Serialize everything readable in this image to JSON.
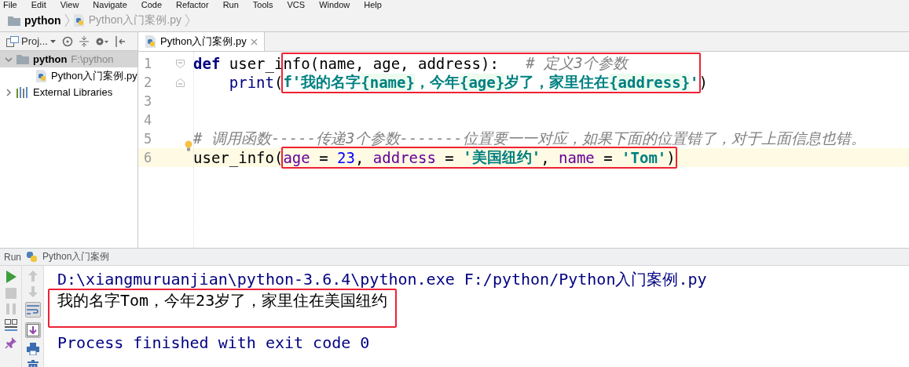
{
  "menu": [
    "File",
    "Edit",
    "View",
    "Navigate",
    "Code",
    "Refactor",
    "Run",
    "Tools",
    "VCS",
    "Window",
    "Help"
  ],
  "breadcrumb": [
    {
      "label": "python",
      "kind": "folder"
    },
    {
      "label": "Python入门案例.py",
      "kind": "file"
    }
  ],
  "project_panel": {
    "title": "Proj...",
    "tree": [
      {
        "label": "python",
        "path": "F:\\python",
        "kind": "folder",
        "expanded": true,
        "selected": true,
        "children": [
          {
            "label": "Python入门案例.py",
            "kind": "file",
            "selected": false
          }
        ]
      },
      {
        "label": "External Libraries",
        "kind": "library",
        "expanded": false,
        "selected": false
      }
    ]
  },
  "editor": {
    "tabs": [
      {
        "label": "Python入门案例.py",
        "selected": true
      }
    ],
    "lines": [
      {
        "number": "1",
        "current": false,
        "bulb": false,
        "tokens": [
          {
            "text": "def",
            "kind": "keyword",
            "boxed": false
          },
          {
            "text": " user_info",
            "kind": "plain",
            "boxed": false
          },
          {
            "text": "(name, age, address):",
            "kind": "plain",
            "boxed": true
          },
          {
            "text": "   # 定义3个参数",
            "kind": "comment",
            "boxed": true
          }
        ]
      },
      {
        "number": "2",
        "current": false,
        "bulb": false,
        "tokens": [
          {
            "text": "    print",
            "kind": "builtin",
            "boxed": false
          },
          {
            "text": "(",
            "kind": "plain",
            "boxed": false
          },
          {
            "text": "f'我的名字",
            "kind": "string",
            "boxed": true
          },
          {
            "text": "{name}",
            "kind": "interp",
            "boxed": true
          },
          {
            "text": "，今年",
            "kind": "string",
            "boxed": true
          },
          {
            "text": "{age}",
            "kind": "interp",
            "boxed": true
          },
          {
            "text": "岁了，家里住在",
            "kind": "string",
            "boxed": true
          },
          {
            "text": "{address}",
            "kind": "interp",
            "boxed": true
          },
          {
            "text": "'",
            "kind": "string",
            "boxed": true
          },
          {
            "text": ")",
            "kind": "plain",
            "boxed": false
          }
        ]
      },
      {
        "number": "3",
        "current": false,
        "bulb": false
      },
      {
        "number": "4",
        "current": false,
        "bulb": false
      },
      {
        "number": "5",
        "current": false,
        "bulb": true,
        "tokens": [
          {
            "text": "# 调用函数-----传递3个参数-------位置要一一对应，如果下面的位置错了，对于上面信息也错。",
            "kind": "comment",
            "boxed": false
          }
        ]
      },
      {
        "number": "6",
        "current": true,
        "bulb": false,
        "tokens": [
          {
            "text": "user_info(",
            "kind": "plain",
            "boxed": false
          },
          {
            "text": "age",
            "kind": "param",
            "boxed": true
          },
          {
            "text": " = ",
            "kind": "plain",
            "boxed": true
          },
          {
            "text": "23",
            "kind": "number",
            "boxed": true
          },
          {
            "text": ", ",
            "kind": "plain",
            "boxed": true
          },
          {
            "text": "address",
            "kind": "param",
            "boxed": true
          },
          {
            "text": " = ",
            "kind": "plain",
            "boxed": true
          },
          {
            "text": "'美国纽约'",
            "kind": "string",
            "boxed": true
          },
          {
            "text": ", ",
            "kind": "plain",
            "boxed": true
          },
          {
            "text": "name",
            "kind": "param",
            "boxed": true
          },
          {
            "text": " = ",
            "kind": "plain",
            "boxed": true
          },
          {
            "text": "'Tom'",
            "kind": "string",
            "boxed": true
          },
          {
            "text": ")",
            "kind": "plain",
            "boxed": true
          }
        ]
      }
    ]
  },
  "run_panel": {
    "title": "Run",
    "config": "Python入门案例",
    "soft_wrap": true,
    "scroll_to_end": true,
    "output": [
      {
        "text": "D:\\xiangmuruanjian\\python-3.6.4\\python.exe F:/python/Python入门案例.py",
        "kind": "command",
        "boxed": false
      },
      {
        "text": "我的名字Tom，今年23岁了，家里住在美国纽约",
        "kind": "stdout",
        "boxed": true
      },
      {
        "text": "Process finished with exit code 0",
        "kind": "exit",
        "boxed": false
      }
    ]
  }
}
